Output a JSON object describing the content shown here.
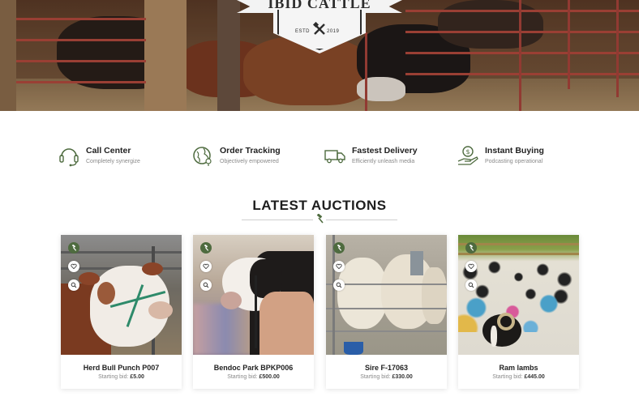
{
  "brand": {
    "name": "IBID CATTLE",
    "estd_label": "ESTD",
    "year": "2019"
  },
  "features": [
    {
      "title": "Call Center",
      "subtitle": "Completely synergize",
      "icon": "headset-icon"
    },
    {
      "title": "Order Tracking",
      "subtitle": "Objectively empowered",
      "icon": "globe-icon"
    },
    {
      "title": "Fastest Delivery",
      "subtitle": "Efficiently unleash media",
      "icon": "truck-icon"
    },
    {
      "title": "Instant Buying",
      "subtitle": "Podcasting operational",
      "icon": "money-hand-icon"
    }
  ],
  "section": {
    "title": "LATEST AUCTIONS"
  },
  "auctions": [
    {
      "title": "Herd Bull Punch P007",
      "bid_label": "Starting bid:",
      "bid_value": "£5.00"
    },
    {
      "title": "Bendoc Park BPKP006",
      "bid_label": "Starting bid:",
      "bid_value": "£500.00"
    },
    {
      "title": "Sire F-17063",
      "bid_label": "Starting bid:",
      "bid_value": "£330.00"
    },
    {
      "title": "Ram lambs",
      "bid_label": "Starting bid:",
      "bid_value": "£445.00"
    }
  ],
  "colors": {
    "accent": "#4e6b3f",
    "title_text": "#1e1e1e",
    "muted_text": "#8a8a8a"
  }
}
